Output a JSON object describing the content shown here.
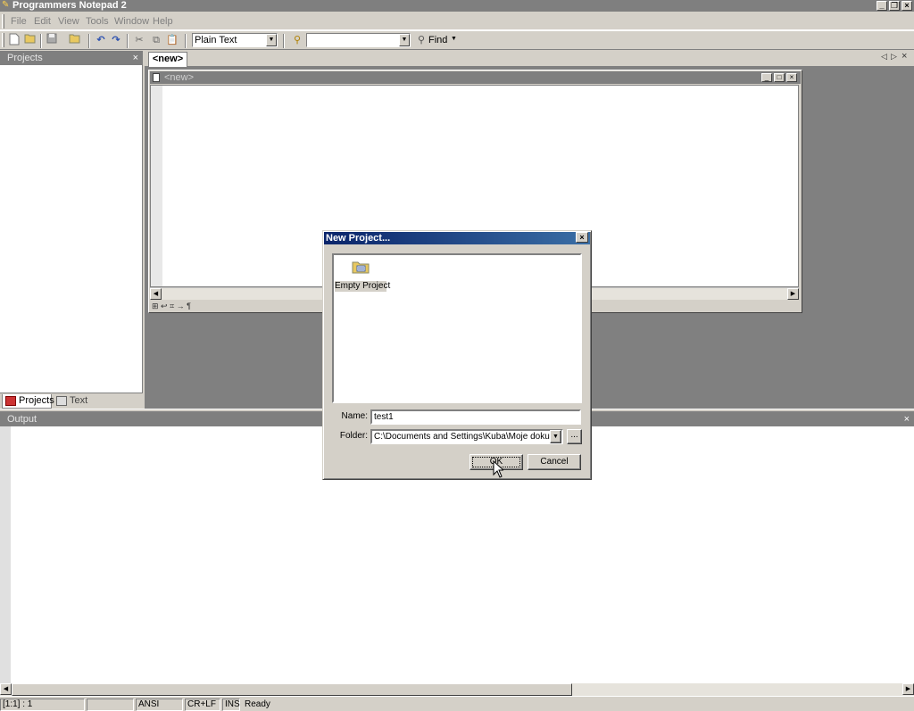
{
  "app": {
    "title": "Programmers Notepad 2"
  },
  "menu": [
    "File",
    "Edit",
    "View",
    "Tools",
    "Window",
    "Help"
  ],
  "toolbar": {
    "scheme_value": "Plain Text",
    "search_value": "",
    "find_label": "Find",
    "icons": [
      "new-file-icon",
      "open-icon",
      "save-icon",
      "open-folder-icon",
      "undo-icon",
      "redo-icon",
      "cut-icon",
      "copy-icon",
      "paste-icon",
      "search-binoculars-icon",
      "find-icon",
      "dropdown-icon"
    ]
  },
  "projects_panel": {
    "title": "Projects",
    "close": "×",
    "tabs": [
      {
        "label": "Projects"
      },
      {
        "label": "Text Clips"
      }
    ]
  },
  "document": {
    "tab_label": "<new>",
    "title": "<new>",
    "status_glyphs": "⊞ ↩ ⌗ → ¶"
  },
  "dialog": {
    "title": "New Project...",
    "close": "×",
    "items": [
      {
        "label": "Empty Project"
      }
    ],
    "name_label": "Name:",
    "name_value": "test1",
    "folder_label": "Folder:",
    "folder_value": "C:\\Documents and Settings\\Kuba\\Moje dokumenty",
    "browse_label": "...",
    "ok_label": "OK",
    "cancel_label": "Cancel"
  },
  "output_panel": {
    "title": "Output",
    "close": "×"
  },
  "statusbar": {
    "position": "[1:1] : 1",
    "empty": "",
    "encoding": "ANSI",
    "line_endings": "CR+LF",
    "mode": "INS",
    "status": "Ready"
  },
  "colors": {
    "titlebar_inactive": "#7f7f7f",
    "dialog_title_active": "#0a246a",
    "face": "#d4d0c8"
  }
}
